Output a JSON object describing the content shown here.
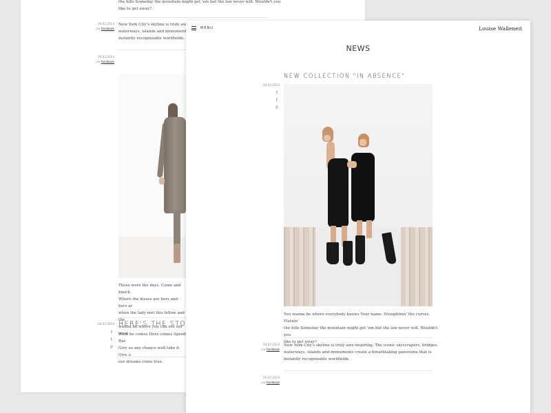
{
  "back_page": {
    "intro_lines": [
      "the hills Someday the mountain might get 'em but the law never will. Wouldn't you",
      "like to get away?"
    ],
    "entries": [
      {
        "date": "04.02.2014",
        "via": "via",
        "source": "facebook",
        "lines": [
          "New York City's skyline is truly awe-in",
          "waterways, islands and monuments cre",
          "instantly recognizable worldwide."
        ]
      },
      {
        "date": "05.02.2014",
        "via": "via",
        "source": "facebook"
      }
    ],
    "caption_lines": [
      "Those were the days. Come and knock",
      "Where the kisses are hers and hers ar",
      "when the lady met this fellow and the",
      "wanna be where you can see our troul"
    ],
    "post2": {
      "date": "04.02.2014",
      "title": "HERE'S THE STORY O",
      "lines": [
        "Here he comes Here comes Speed Rac",
        "Give us any chance well take it. Give u",
        "our dreams come true."
      ]
    }
  },
  "front_page": {
    "menu_label": "MENU",
    "brand": "Louise Walleneit",
    "section_title": "NEWS",
    "post": {
      "title": "NEW COLLECTION \"IN ABSENCE\"",
      "date": "04.02.2014",
      "lines": [
        "You wanna be where everybody knows Your name. Straightnin' the curves. Flatnin'",
        "the hills Someday the mountain might get 'em but the law never will. Wouldn't you",
        "like to get away?"
      ]
    },
    "entries": [
      {
        "date": "04.02.2014",
        "via": "via",
        "source": "facebook",
        "lines": [
          "New York City's skyline is truly awe-inspiring. The iconic skyscrapers, bridges,",
          "waterways, islands and monuments create a breathtaking panorama that is",
          "instantly recognizable worldwide."
        ]
      },
      {
        "date": "05.02.2014",
        "via": "via",
        "source": "facebook"
      }
    ]
  },
  "icons": {
    "facebook": "f",
    "twitter": "t",
    "pinterest": "p"
  },
  "colors": {
    "background": "#e8e8e8",
    "page": "#ffffff",
    "text": "#333333"
  }
}
